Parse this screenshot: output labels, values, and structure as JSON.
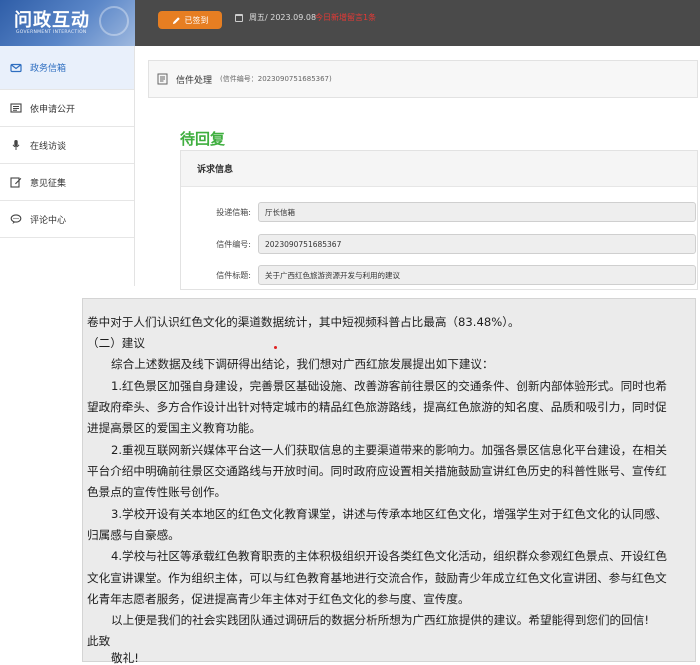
{
  "header": {
    "logo_title": "问政互动",
    "logo_subtitle": "GOVERNMENT INTERACTION",
    "signed_label": "已签到",
    "date": "周五/ 2023.09.08",
    "status": "今日新增留言1条",
    "colors": {
      "bar": "#4a4a4a",
      "accent": "#e67e22",
      "status": "#e53935"
    }
  },
  "sidebar": {
    "items": [
      {
        "label": "政务信箱",
        "icon": "mail-icon",
        "active": true
      },
      {
        "label": "依申请公开",
        "icon": "list-icon"
      },
      {
        "label": "在线访谈",
        "icon": "microphone-icon"
      },
      {
        "label": "意见征集",
        "icon": "edit-icon"
      },
      {
        "label": "评论中心",
        "icon": "comment-icon"
      }
    ]
  },
  "main": {
    "title": "信件处理",
    "letter_no_text": "(信件编号：2023090751685367)",
    "status_heading": "待回复",
    "status_color": "#3fae3f",
    "section_title": "诉求信息",
    "fields": [
      {
        "label": "投递信箱:",
        "value": "厅长信箱"
      },
      {
        "label": "信件编号:",
        "value": "2023090751685367"
      },
      {
        "label": "信件标题:",
        "value": "关于广西红色旅游资源开发与利用的建议"
      }
    ]
  },
  "document": {
    "lines": [
      "卷中对于人们认识红色文化的渠道数据统计，其中短视频科普占比最高（83.48%）。",
      "（二）建议",
      "综合上述数据及线下调研得出结论，我们想对广西红旅发展提出如下建议：",
      "1.红色景区加强自身建设，完善景区基础设施、改善游客前往景区的交通条件、创新内部体验形式。同时也希",
      "望政府牵头、多方合作设计出针对特定城市的精品红色旅游路线，提高红色旅游的知名度、品质和吸引力，同时促",
      "进提高景区的爱国主义教育功能。",
      "2.重视互联网新兴媒体平台这一人们获取信息的主要渠道带来的影响力。加强各景区信息化平台建设，在相关",
      "平台介绍中明确前往景区交通路线与开放时间。同时政府应设置相关措施鼓励宣讲红色历史的科普性账号、宣传红",
      "色景点的宣传性账号创作。",
      "3.学校开设有关本地区的红色文化教育课堂，讲述与传承本地区红色文化，增强学生对于红色文化的认同感、",
      "归属感与自豪感。",
      "4.学校与社区等承载红色教育职责的主体积极组织开设各类红色文化活动，组织群众参观红色景点、开设红色",
      "文化宣讲课堂。作为组织主体，可以与红色教育基地进行交流合作，鼓励青少年成立红色文化宣讲团、参与红色文",
      "化青年志愿者服务，促进提高青少年主体对于红色文化的参与度、宣传度。",
      "以上便是我们的社会实践团队通过调研后的数据分析所想为广西红旅提供的建议。希望能得到您们的回信!",
      "此致",
      "敬礼!"
    ]
  }
}
